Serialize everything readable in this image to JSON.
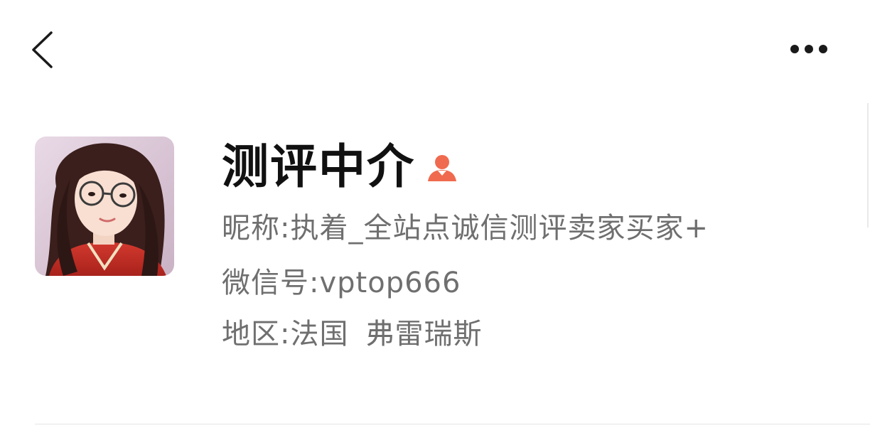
{
  "header": {
    "back_icon": "chevron-left-icon",
    "more_icon": "more-horizontal-icon"
  },
  "profile": {
    "display_name": "测评中介",
    "gender_icon": "female-user-icon",
    "gender_color": "#f06a4f",
    "nickname_label": "昵称:",
    "nickname_value": "执着_全站点诚信测评卖家买家+",
    "wechat_label": "微信号:",
    "wechat_value": "vptop666",
    "region_label": "地区:",
    "region_country": "法国",
    "region_city": "弗雷瑞斯"
  },
  "colors": {
    "name_text": "#111111",
    "secondary_text": "#6f6f6f",
    "divider": "#e5e5e5"
  }
}
